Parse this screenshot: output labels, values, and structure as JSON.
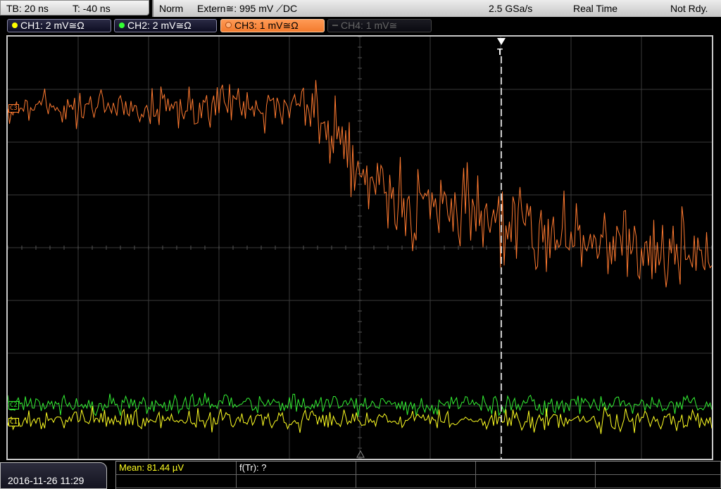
{
  "top": {
    "timebase": "TB: 20 ns",
    "trigger_time": "T: -40 ns",
    "mode": "Norm",
    "trigger_source": "Extern≅: 995 mV ⟋DC",
    "sample_rate": "2.5 GSa/s",
    "acq_mode": "Real Time",
    "status": "Not Rdy."
  },
  "channels": [
    {
      "label": "CH1: 2 mV≅Ω",
      "color": "#ffff00",
      "state": "on"
    },
    {
      "label": "CH2: 2 mV≅Ω",
      "color": "#33ff33",
      "state": "on"
    },
    {
      "label": "CH3: 1 mV≅Ω",
      "color": "#ff7a30",
      "state": "active"
    },
    {
      "label": "CH4: 1 mV≅",
      "color": "#777777",
      "state": "off"
    }
  ],
  "markers": {
    "ch3": "C3",
    "ch2": "C2",
    "ch1": "C1",
    "trigger": "T"
  },
  "bottom": {
    "datetime": "2016-11-26 11:29",
    "measure1": "Mean: 81.44 µV",
    "measure2": "f(Tr): ?"
  }
}
